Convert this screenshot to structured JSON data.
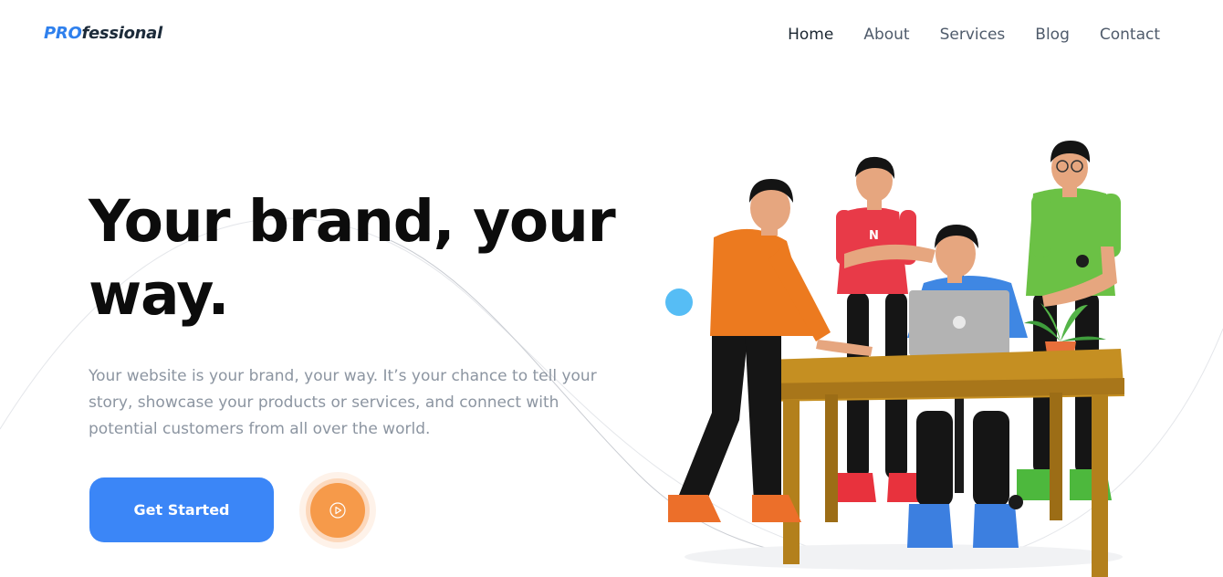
{
  "brand": {
    "prefix": "PRO",
    "rest": "fessional"
  },
  "nav": {
    "items": [
      {
        "label": "Home",
        "active": true
      },
      {
        "label": "About",
        "active": false
      },
      {
        "label": "Services",
        "active": false
      },
      {
        "label": "Blog",
        "active": false
      },
      {
        "label": "Contact",
        "active": false
      }
    ]
  },
  "hero": {
    "title": "Your brand, your way.",
    "description": "Your website is your brand, your way. It’s your chance to tell your story, showcase your products or services, and connect with potential customers from all over the world.",
    "cta_label": "Get Started",
    "play_icon": "play-circle-icon"
  },
  "illustration": {
    "shirt_letter": "N",
    "icon": "team-at-desk-illustration"
  },
  "colors": {
    "accent": "#3b86f7",
    "brand_blue": "#2f80ed",
    "play_orange": "#f69a4a",
    "dot_blue": "#56bdf5",
    "title": "#0c0c0c",
    "body_text": "#8c95a1"
  }
}
